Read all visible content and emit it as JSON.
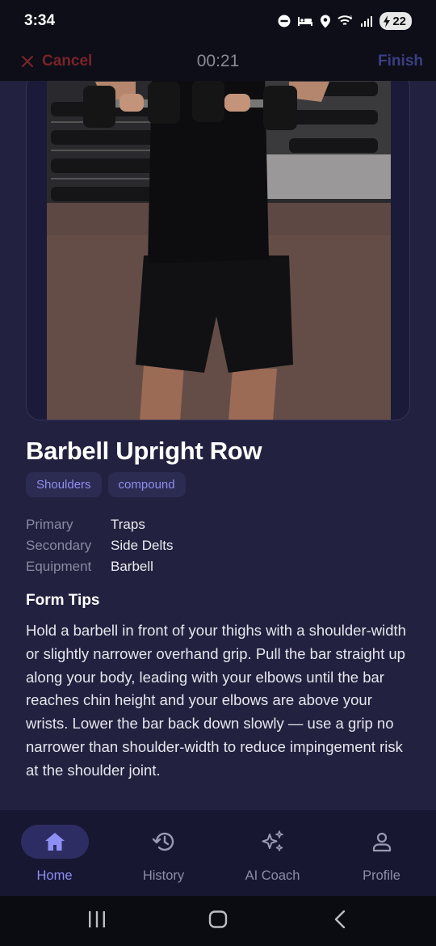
{
  "status_bar": {
    "time": "3:34",
    "battery": "22",
    "icons": [
      "dnd-icon",
      "sleep-icon",
      "location-icon",
      "wifi-icon",
      "signal-icon",
      "battery-icon"
    ]
  },
  "top_bar": {
    "cancel_label": "Cancel",
    "timer": "00:21",
    "finish_label": "Finish"
  },
  "exercise": {
    "title": "Barbell Upright Row",
    "tags": [
      "Shoulders",
      "compound"
    ],
    "details": [
      {
        "label": "Primary",
        "value": "Traps"
      },
      {
        "label": "Secondary",
        "value": "Side Delts"
      },
      {
        "label": "Equipment",
        "value": "Barbell"
      }
    ],
    "tips_title": "Form Tips",
    "tips_body": "Hold a barbell in front of your thighs with a shoulder-width or slightly narrower overhand grip. Pull the bar straight up along your body, leading with your elbows until the bar reaches chin height and your elbows are above your wrists. Lower the bar back down slowly — use a grip no narrower than shoulder-width to reduce impingement risk at the shoulder joint."
  },
  "bottom_nav": [
    {
      "label": "Home",
      "icon": "home-icon",
      "active": true
    },
    {
      "label": "History",
      "icon": "history-icon",
      "active": false
    },
    {
      "label": "AI Coach",
      "icon": "sparkles-icon",
      "active": false
    },
    {
      "label": "Profile",
      "icon": "profile-icon",
      "active": false
    }
  ],
  "colors": {
    "background": "#22213f",
    "cancel": "#7a2329",
    "finish": "#3b3f82",
    "accent": "#8d8ff5",
    "tag_bg": "#2c2b52"
  }
}
